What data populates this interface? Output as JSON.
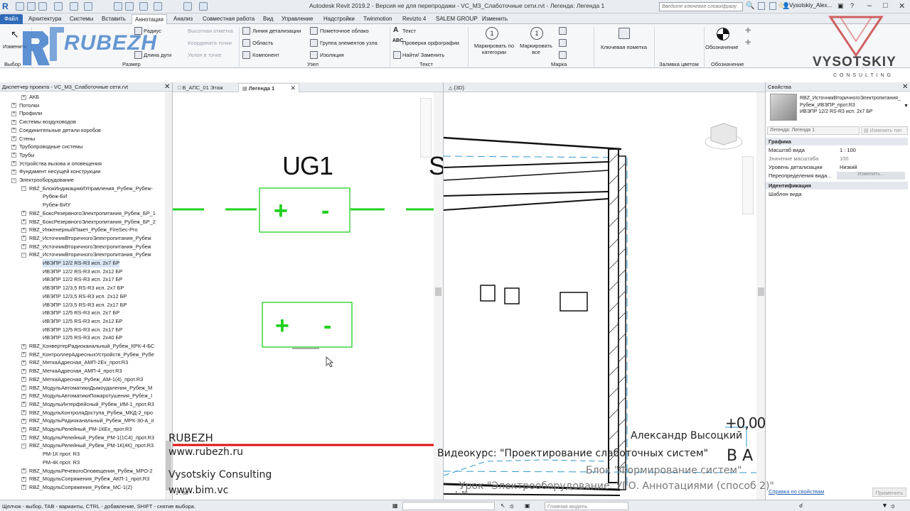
{
  "app": {
    "title": "Autodesk Revit 2019.2 - Версия не для перепродажи - VC_M3_Слаботочные сети.rvt - Легенда: Легенда 1"
  },
  "search": {
    "placeholder": "Введите ключевое слово/фразу"
  },
  "user": {
    "name": "Vysotskiy_Alex..."
  },
  "ribbon_tabs": [
    "Файл",
    "Архитектура",
    "Системы",
    "Вставить",
    "Аннотации",
    "Анализ",
    "Совместная работа",
    "Вид",
    "Управление",
    "Надстройки",
    "Twinmotion",
    "Revizto 4",
    "SALEM GROUP",
    "Изменить"
  ],
  "ribbon": {
    "modify": "Изменить",
    "radius": "Радиус",
    "arc_length": "Длина дуги",
    "dim_spot_elev": "Высотная отметка",
    "dim_spot_coord": "Координата точки",
    "dim_spot_slope": "Уклон в точке",
    "detail_line": "Линия детализации",
    "region": "Область",
    "component": "Компонент",
    "revision_cloud": "Пометочное облако",
    "detail_group": "Группа элементов узла",
    "insulation": "Изоляция",
    "text": "Текст",
    "spell_check": "Проверка орфографии",
    "find_replace": "Найти/ Заменить",
    "tag_by_category": "Маркировать по категории",
    "tag_all": "Маркировать все",
    "keynote": "Ключевая пометка",
    "symbol": "Обозначение",
    "groups": {
      "select": "Выбор",
      "dimension": "Размер",
      "detail": "Узел",
      "text": "Текст",
      "tag": "Марка",
      "color_fill": "Заливка цветом",
      "symbol": "Обозначение"
    }
  },
  "logos": {
    "rubezh": "RUBEZH",
    "vysotskiy": "VYSOTSKIY",
    "vysotskiy_sub": "C O N S U L T I N G"
  },
  "project_browser": {
    "title": "Диспетчер проекта - VC_M3_Слаботочные сети.rvt",
    "items": [
      {
        "label": "АКБ",
        "level": 2,
        "toggle": "+"
      },
      {
        "label": "Потолки",
        "level": 1,
        "toggle": "+"
      },
      {
        "label": "Профили",
        "level": 1,
        "toggle": "+"
      },
      {
        "label": "Системы воздуховодов",
        "level": 1,
        "toggle": "+"
      },
      {
        "label": "Соединительные детали коробов",
        "level": 1,
        "toggle": "+"
      },
      {
        "label": "Стены",
        "level": 1,
        "toggle": "+"
      },
      {
        "label": "Трубопроводные системы",
        "level": 1,
        "toggle": "+"
      },
      {
        "label": "Трубы",
        "level": 1,
        "toggle": "+"
      },
      {
        "label": "Устройства вызова и оповещения",
        "level": 1,
        "toggle": "+"
      },
      {
        "label": "Фундамент несущей конструкции",
        "level": 1,
        "toggle": "+"
      },
      {
        "label": "Электрооборудование",
        "level": 1,
        "toggle": "−"
      },
      {
        "label": "RBZ_БлокИндикацииИУправления_Рубеж_Рубеж-",
        "level": 2,
        "toggle": "−"
      },
      {
        "label": "Рубеж-БИ",
        "level": 3,
        "toggle": ""
      },
      {
        "label": "Рубеж-БИУ",
        "level": 3,
        "toggle": ""
      },
      {
        "label": "RBZ_БоксРезервногоЭлектропитания_Рубеж_БР_1",
        "level": 2,
        "toggle": "+"
      },
      {
        "label": "RBZ_БоксРезервногоЭлектропитания_Рубеж_БР_2",
        "level": 2,
        "toggle": "+"
      },
      {
        "label": "RBZ_ИнженерныйПакет_Рубеж_FireSec-Pro",
        "level": 2,
        "toggle": "+"
      },
      {
        "label": "RBZ_ИсточникВторичногоЭлектропитания_Рубеж",
        "level": 2,
        "toggle": "+"
      },
      {
        "label": "RBZ_ИсточникВторичногоЭлектропитания_Рубеж",
        "level": 2,
        "toggle": "+"
      },
      {
        "label": "RBZ_ИсточникВторичногоЭлектропитания_Рубеж",
        "level": 2,
        "toggle": "−"
      },
      {
        "label": "ИВЭПР 12/2 RS-R3 исп. 2x7 БР",
        "level": 3,
        "toggle": "",
        "selected": true
      },
      {
        "label": "ИВЭПР 12/2 RS-R3 исп. 2x12 БР",
        "level": 3,
        "toggle": ""
      },
      {
        "label": "ИВЭПР 12/2 RS-R3 исп. 2x17 БР",
        "level": 3,
        "toggle": ""
      },
      {
        "label": "ИВЭПР 12/3,5 RS-R3 исп. 2x7 БР",
        "level": 3,
        "toggle": ""
      },
      {
        "label": "ИВЭПР 12/3,5 RS-R3 исп. 2x12 БР",
        "level": 3,
        "toggle": ""
      },
      {
        "label": "ИВЭПР 12/3,5 RS-R3 исп. 2x17 БР",
        "level": 3,
        "toggle": ""
      },
      {
        "label": "ИВЭПР 12/5 RS-R3 исп. 2x7 БР",
        "level": 3,
        "toggle": ""
      },
      {
        "label": "ИВЭПР 12/5 RS-R3 исп. 2x12 БР",
        "level": 3,
        "toggle": ""
      },
      {
        "label": "ИВЭПР 12/5 RS-R3 исп. 2x17 БР",
        "level": 3,
        "toggle": ""
      },
      {
        "label": "ИВЭПР 12/5 RS-R3 исп. 2x40 БР",
        "level": 3,
        "toggle": ""
      },
      {
        "label": "RBZ_КонвертерРадиоканальный_Рубеж_КРК-4-БС",
        "level": 2,
        "toggle": "+"
      },
      {
        "label": "RBZ_КонтроллерАдресныхУстройств_Рубеж_Рубе",
        "level": 2,
        "toggle": "+"
      },
      {
        "label": "RBZ_МеткаАдресная_АМП-2Ех_прот.R3",
        "level": 2,
        "toggle": "+"
      },
      {
        "label": "RBZ_МеткаАдресная_АМП-4_прот.R3",
        "level": 2,
        "toggle": "+"
      },
      {
        "label": "RBZ_МеткаАдресная_Рубеж_АМ-1(4)_прот.R3",
        "level": 2,
        "toggle": "+"
      },
      {
        "label": "RBZ_МодульАвтоматикиДымоудаления_Рубеж_М",
        "level": 2,
        "toggle": "+"
      },
      {
        "label": "RBZ_МодульАвтоматикиПожаротушения_Рубеж_I",
        "level": 2,
        "toggle": "+"
      },
      {
        "label": "RBZ_МодульИнтерфейсный_Рубеж_ИМ-1_прот.R3",
        "level": 2,
        "toggle": "+"
      },
      {
        "label": "RBZ_МодульКонтроляДоступа_Рубеж_МКД-2_про",
        "level": 2,
        "toggle": "+"
      },
      {
        "label": "RBZ_МодульРадиоканальный_Рубеж_МРК-30-А_п",
        "level": 2,
        "toggle": "+"
      },
      {
        "label": "RBZ_МодульРелейный_РМ-1КЕх_прот.R3",
        "level": 2,
        "toggle": "+"
      },
      {
        "label": "RBZ_МодульРелейный_Рубеж_РМ-1(1С4)_прот.R3",
        "level": 2,
        "toggle": "+"
      },
      {
        "label": "RBZ_МодульРелейный_Рубеж_РМ-1К(4К)_прот.R3",
        "level": 2,
        "toggle": "−"
      },
      {
        "label": "РМ-1К прот. R3",
        "level": 3,
        "toggle": ""
      },
      {
        "label": "РМ-4К прот. R3",
        "level": 3,
        "toggle": ""
      },
      {
        "label": "RBZ_МодульРечевогоОповещения_Рубеж_МРО-2",
        "level": 2,
        "toggle": "+"
      },
      {
        "label": "RBZ_МодульСопряжения_Рубеж_АКП-1_прот.R3",
        "level": 2,
        "toggle": "+"
      },
      {
        "label": "RBZ_МодульСопряжения_Рубеж_МС-1(2)",
        "level": 2,
        "toggle": "+"
      }
    ]
  },
  "views": {
    "tabs": [
      {
        "label": "В_АПС_01 Этаж",
        "active": false
      },
      {
        "label": "Легенда 1",
        "active": true
      },
      {
        "label": "{3D}",
        "active": false
      }
    ],
    "legend_label": "UG1",
    "plus": "+",
    "minus": "-",
    "scale": "1 : 50"
  },
  "properties": {
    "title": "Свойства",
    "type_name": "RBZ_ИсточникВторичногоЭлектропитания_Рубеж_ИВЭПР_прот.R3",
    "type_variant": "ИВЭПР 12/2 RS-R3 исп. 2x7 БР",
    "instance_filter": "Легенда: Легенда 1",
    "edit_type": "Изменить тип",
    "section_graphics": "Графика",
    "view_scale_label": "Масштаб вида",
    "view_scale_value": "1 : 100",
    "scale_value_label": "Значение масштаба",
    "scale_value_value": "100",
    "detail_level_label": "Уровень детализации",
    "detail_level_value": "Низкий",
    "overrides_label": "Переопределения вида...",
    "overrides_btn": "Изменить...",
    "section_identity": "Идентификация",
    "view_template_label": "Шаблон вида",
    "help_link": "Справка по свойствам",
    "apply": "Применить"
  },
  "statusbar": {
    "hint": "Щелчок - выбор, TAB - варианты, CTRL - добавление, SHIFT - снятие выбора.",
    "zero": ":0",
    "model": "Главная модель"
  },
  "overlay": {
    "brand": "RUBEZH",
    "brand_url": "www.rubezh.ru",
    "consulting": "Vysotskiy Consulting",
    "consulting_url": "www.bim.vc",
    "author": "Александр Высоцкий",
    "course": "Видеокурс: \"Проектирование слаботочных систем\"",
    "block": "Блок \"Формирование систем\"",
    "lesson": "Урок \"Электрооборудование. УГО. Аннотациями (способ 2)\"",
    "elevation": "+0,00",
    "section_tag": "В А"
  },
  "colors": {
    "green": "#20d020",
    "red": "#e01010",
    "cyan": "#3399cc"
  }
}
